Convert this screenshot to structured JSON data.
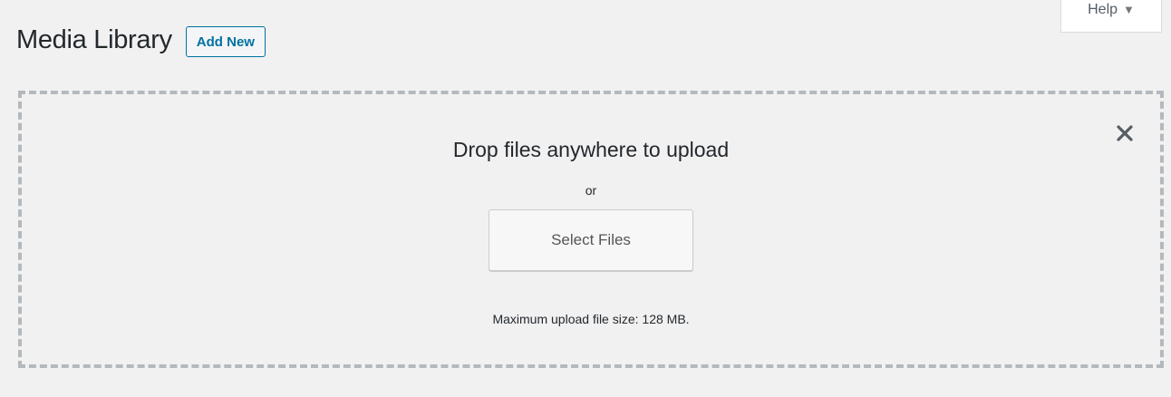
{
  "header": {
    "title": "Media Library",
    "add_new_label": "Add New"
  },
  "help": {
    "label": "Help",
    "arrow_icon": "triangle-down-icon"
  },
  "uploader": {
    "title": "Drop files anywhere to upload",
    "or_text": "or",
    "select_files_label": "Select Files",
    "max_size_text": "Maximum upload file size: 128 MB.",
    "close_icon": "close-icon"
  },
  "colors": {
    "background": "#f1f1f1",
    "accent": "#0071a1",
    "dashed_border": "#b4b9be",
    "text": "#23282d"
  }
}
